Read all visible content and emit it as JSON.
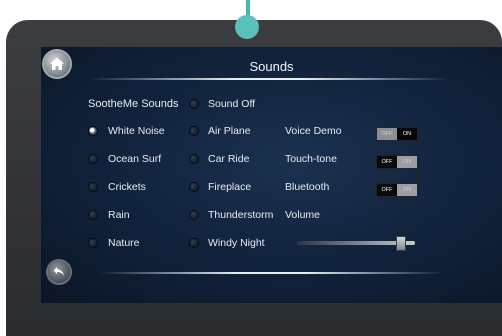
{
  "header": {
    "title": "Sounds"
  },
  "icons": {
    "home": "home-icon",
    "back": "back-arrow-icon"
  },
  "colors": {
    "accent": "#58c1ba",
    "bezel": "#333437",
    "screen": "#10213a"
  },
  "sounds": {
    "heading": "SootheMe Sounds",
    "column1": [
      {
        "label": "White Noise",
        "selected": true
      },
      {
        "label": "Ocean Surf",
        "selected": false
      },
      {
        "label": "Crickets",
        "selected": false
      },
      {
        "label": "Rain",
        "selected": false
      },
      {
        "label": "Nature",
        "selected": false
      }
    ],
    "column2": [
      {
        "label": "Sound Off",
        "selected": false
      },
      {
        "label": "Air Plane",
        "selected": false
      },
      {
        "label": "Car Ride",
        "selected": false
      },
      {
        "label": "Fireplace",
        "selected": false
      },
      {
        "label": "Thunderstorm",
        "selected": false
      },
      {
        "label": "Windy Night",
        "selected": false
      }
    ]
  },
  "settings": {
    "voice_demo": {
      "label": "Voice Demo",
      "off": "OFF",
      "on": "ON",
      "state": "on"
    },
    "touch_tone": {
      "label": "Touch-tone",
      "off": "OFF",
      "on": "ON",
      "state": "off"
    },
    "bluetooth": {
      "label": "Bluetooth",
      "off": "OFF",
      "on": "ON",
      "state": "off"
    },
    "volume": {
      "label": "Volume",
      "level": 0.88
    }
  }
}
